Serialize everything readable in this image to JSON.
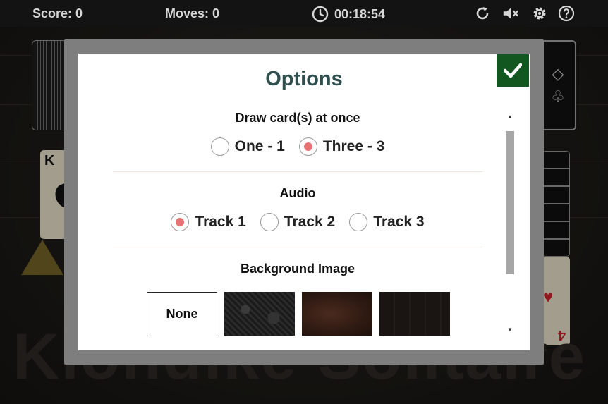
{
  "header": {
    "score_label": "Score: 0",
    "moves_label": "Moves: 0",
    "timer": "00:18:54",
    "icons": [
      "clock-icon",
      "restart-icon",
      "mute-icon",
      "gear-icon",
      "help-icon"
    ]
  },
  "table": {
    "king_rank": "K",
    "four_rank": "4",
    "watermark": "Klondike Solitaire"
  },
  "modal": {
    "title": "Options",
    "sections": {
      "draw": {
        "title": "Draw card(s) at once",
        "options": [
          "One - 1",
          "Three - 3"
        ],
        "selected": "Three - 3"
      },
      "audio": {
        "title": "Audio",
        "options": [
          "Track 1",
          "Track 2",
          "Track 3"
        ],
        "selected": "Track 1"
      },
      "background": {
        "title": "Background Image",
        "none_label": "None"
      }
    }
  },
  "colors": {
    "confirm_bg": "#12571f",
    "title_color": "#2f4e4e",
    "radio_selected": "#e57373"
  }
}
